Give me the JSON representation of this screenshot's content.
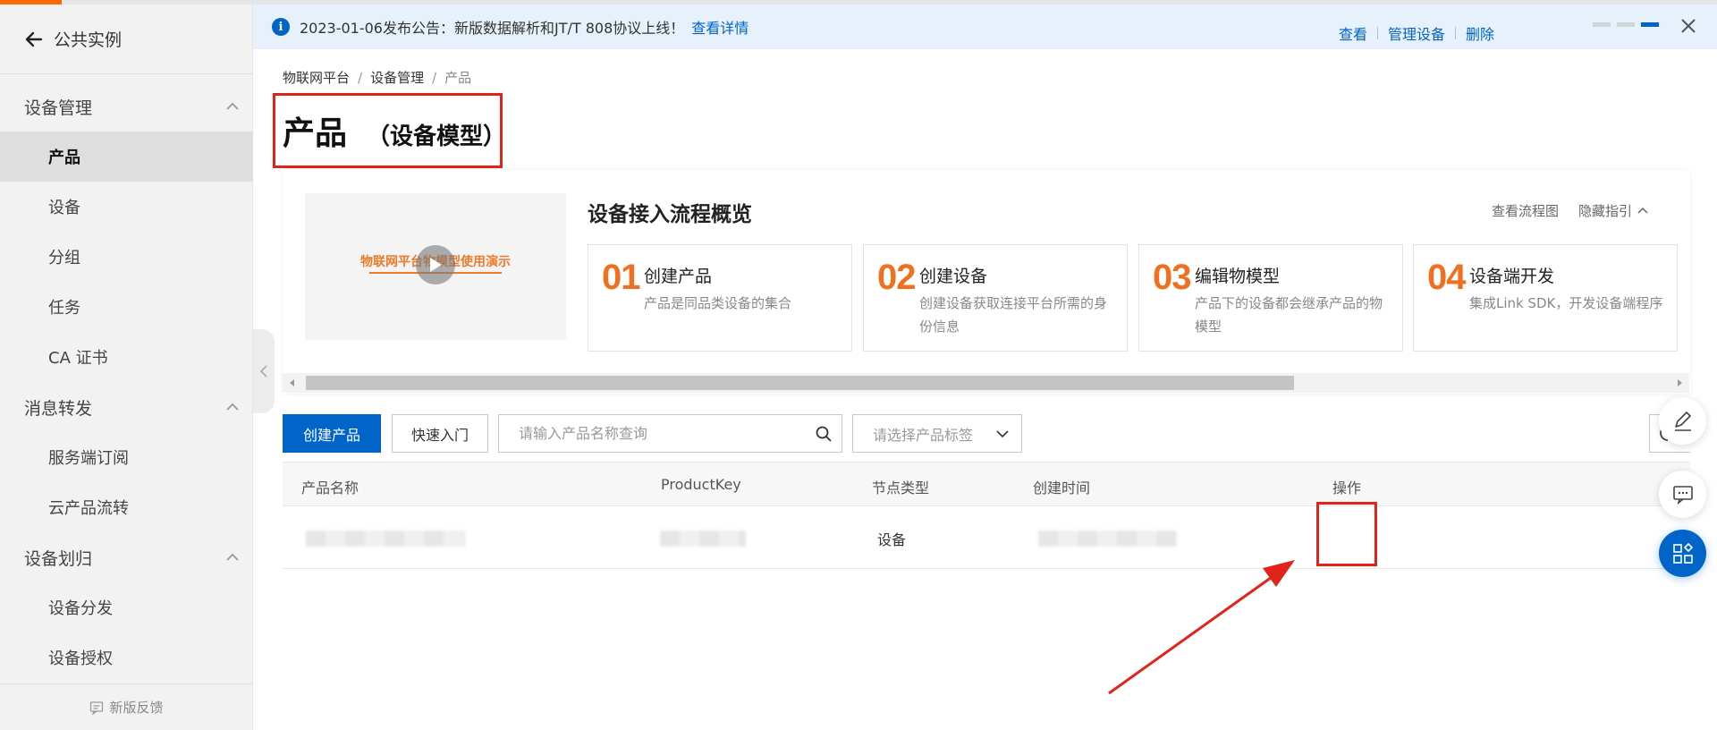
{
  "sidebar": {
    "back_label": "公共实例",
    "groups": [
      {
        "label": "设备管理",
        "items": [
          "产品",
          "设备",
          "分组",
          "任务",
          "CA 证书"
        ]
      },
      {
        "label": "消息转发",
        "items": [
          "服务端订阅",
          "云产品流转"
        ]
      },
      {
        "label": "设备划归",
        "items": [
          "设备分发",
          "设备授权"
        ]
      }
    ],
    "active_item": "产品",
    "feedback": "新版反馈"
  },
  "notice": {
    "text": "2023-01-06发布公告：新版数据解析和JT/T 808协议上线！",
    "link": "查看详情"
  },
  "breadcrumb": [
    "物联网平台",
    "设备管理",
    "产品"
  ],
  "page": {
    "title": "产品",
    "subtitle": "（设备模型）"
  },
  "guide": {
    "video_title": "物联网平台物模型使用演示",
    "title": "设备接入流程概览",
    "links": [
      "查看流程图",
      "隐藏指引"
    ],
    "steps": [
      {
        "num": "01",
        "title": "创建产品",
        "desc": "产品是同品类设备的集合"
      },
      {
        "num": "02",
        "title": "创建设备",
        "desc": "创建设备获取连接平台所需的身份信息"
      },
      {
        "num": "03",
        "title": "编辑物模型",
        "desc": "产品下的设备都会继承产品的物模型"
      },
      {
        "num": "04",
        "title": "设备端开发",
        "desc": "集成Link SDK，开发设备端程序"
      }
    ]
  },
  "toolbar": {
    "create_label": "创建产品",
    "quick_label": "快速入门",
    "search_placeholder": "请输入产品名称查询",
    "tag_placeholder": "请选择产品标签"
  },
  "table": {
    "columns": [
      "产品名称",
      "ProductKey",
      "节点类型",
      "创建时间",
      "操作"
    ],
    "rows": [
      {
        "node_type": "设备",
        "actions": [
          "查看",
          "管理设备",
          "删除"
        ]
      }
    ]
  },
  "colors": {
    "primary": "#0064c8",
    "accent_orange": "#f07020",
    "annotation_red": "#e2231a"
  }
}
